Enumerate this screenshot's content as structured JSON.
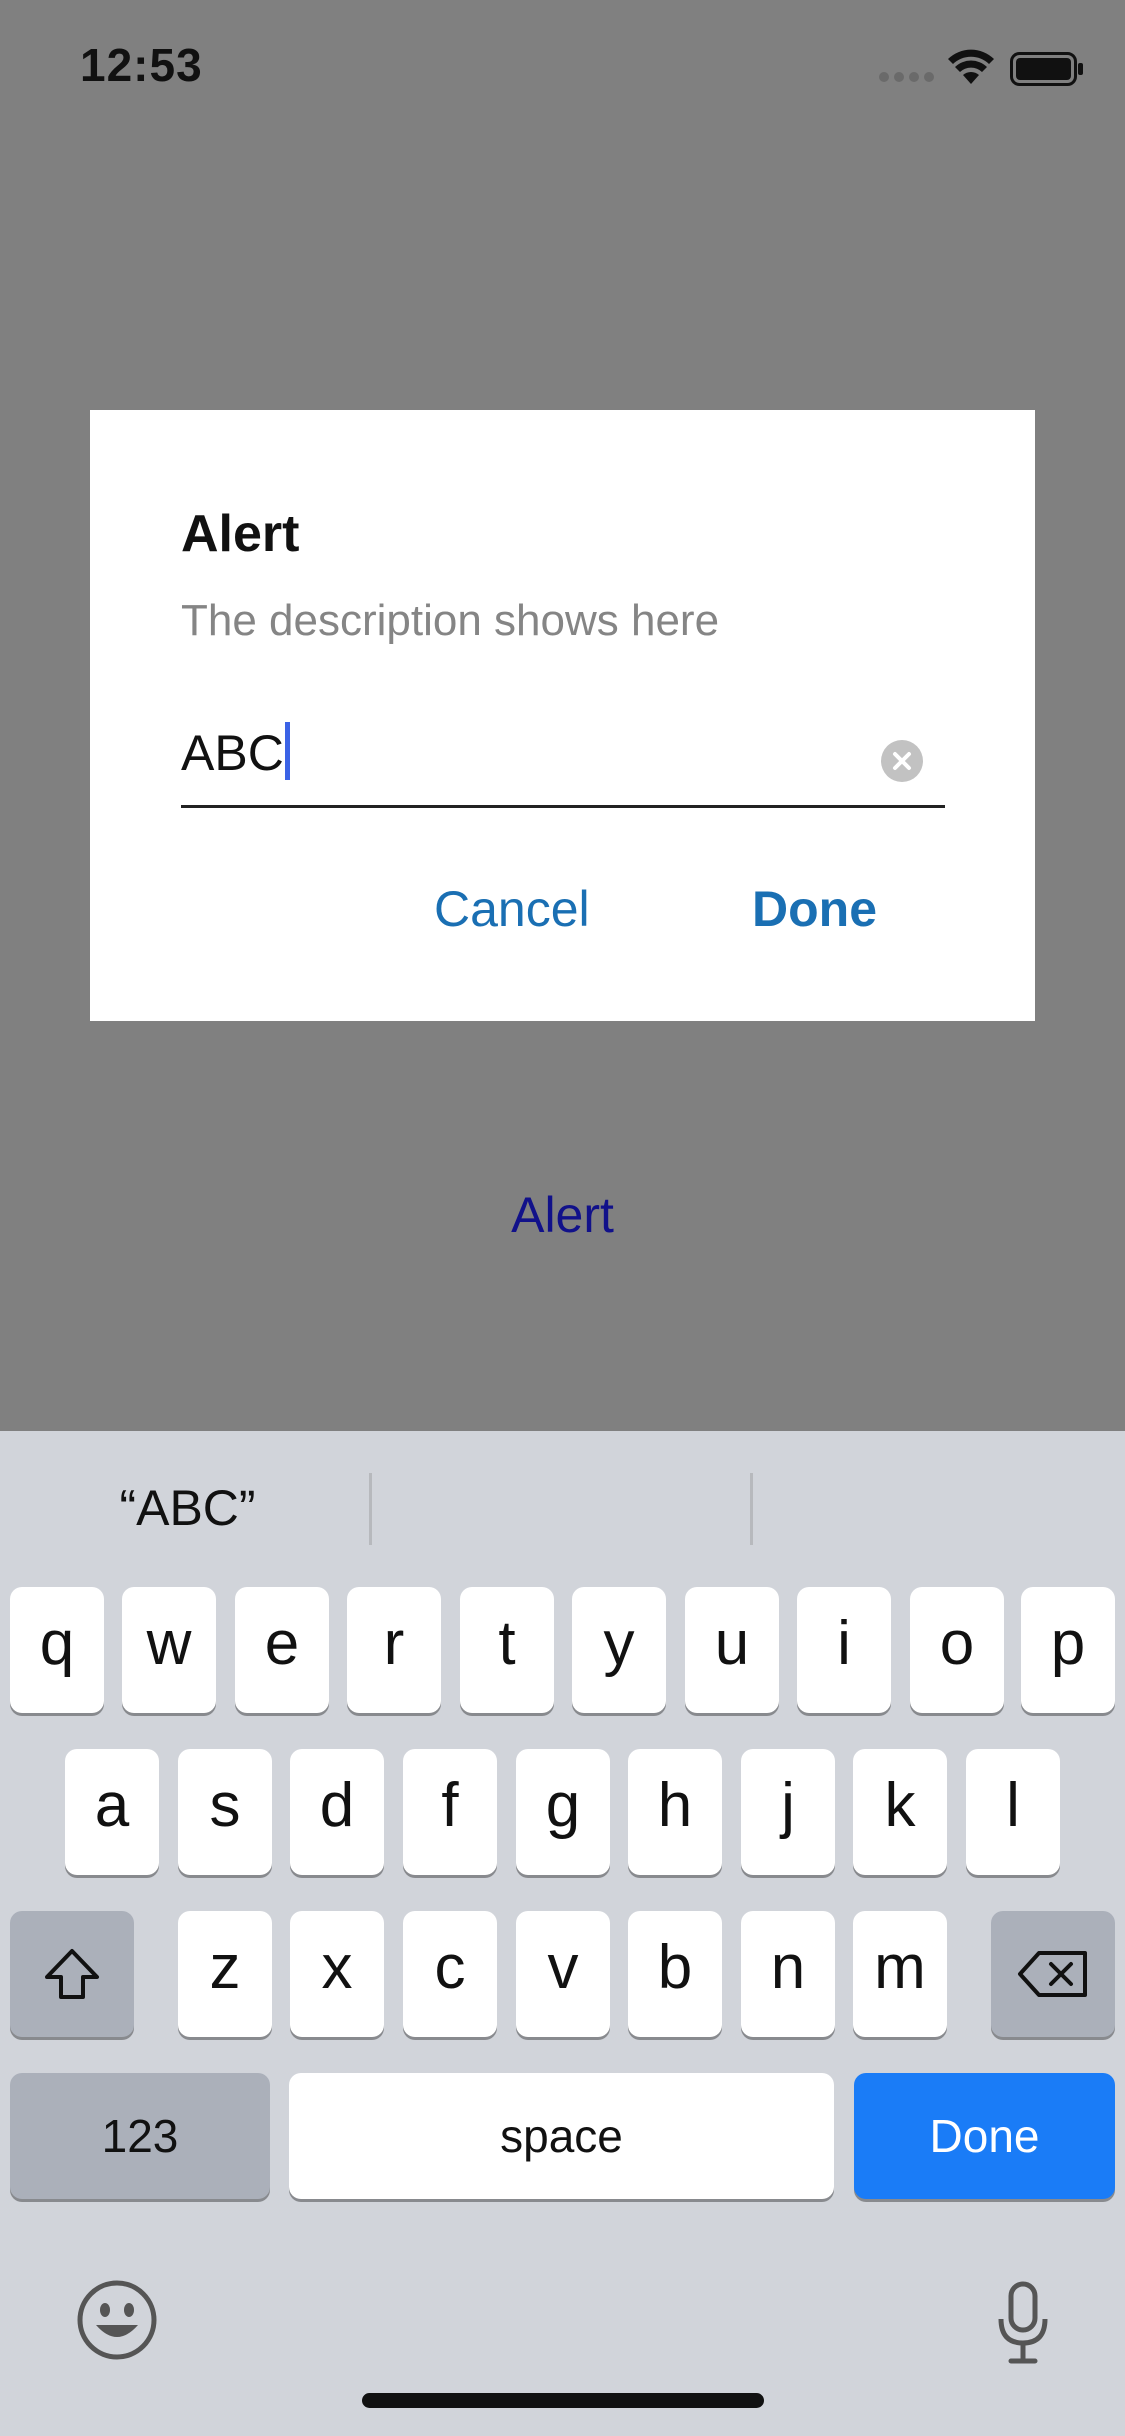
{
  "status_bar": {
    "time": "12:53",
    "icons": [
      "signal-icon",
      "wifi-icon",
      "battery-icon"
    ]
  },
  "dialog": {
    "title": "Alert",
    "description": "The description shows here",
    "input_value": "ABC",
    "cancel_label": "Cancel",
    "done_label": "Done",
    "accent_color": "#1a6fb3"
  },
  "background": {
    "link_label": "Alert",
    "link_color": "#11118a"
  },
  "keyboard": {
    "suggestions": [
      "“ABC”",
      "",
      ""
    ],
    "row1": [
      "q",
      "w",
      "e",
      "r",
      "t",
      "y",
      "u",
      "i",
      "o",
      "p"
    ],
    "row2": [
      "a",
      "s",
      "d",
      "f",
      "g",
      "h",
      "j",
      "k",
      "l"
    ],
    "row3": [
      "z",
      "x",
      "c",
      "v",
      "b",
      "n",
      "m"
    ],
    "numbers_label": "123",
    "space_label": "space",
    "return_label": "Done",
    "return_color": "#1a7cf7",
    "icons": [
      "shift-icon",
      "delete-icon",
      "emoji-icon",
      "microphone-icon"
    ]
  }
}
